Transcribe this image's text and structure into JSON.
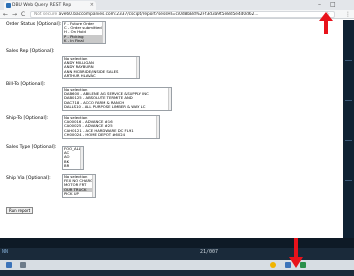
{
  "browser": {
    "tab_title": "DBU Web Query REST Rep",
    "tab_close": "×",
    "win_min": "–",
    "win_max": "□",
    "back": "←",
    "forward": "→",
    "reload": "C",
    "not_secure": "Not secure",
    "url": "ave60.baccompanies.com:2337/cscipt/report?sessHI=ci0d8bBd%2Ff3d3a9t5e8d5e4d0d62...",
    "star": "☆",
    "menu": "⋮"
  },
  "form": {
    "order_status": {
      "label": "Order Status [Optional]:",
      "options": [
        "F - Future Order",
        "C - Order submitted",
        "H - On Hold",
        "P - Picking",
        "K - In Final"
      ],
      "highlighted": [
        3,
        4
      ]
    },
    "sales_rep": {
      "label": "Sales Rep [Optional]:",
      "options": [
        "No selection",
        "ANDY MILLIGAN",
        "ANDY RAYBURN",
        "ANN MCBRIDE/INSIDE SALES",
        "ARTHUR HLAVAC"
      ]
    },
    "bill_to": {
      "label": "Bill-To [Optional]:",
      "options": [
        "No selection",
        "DAB600 - ABILENE AG SERVICE &SUPPLY INC",
        "DAB0125 - ABSOLUTE TERMITE AND",
        "DAC718 - ACCO FARM & RANCH",
        "DALLS10 - ALL PURPOSE LIMBER & WAY LC"
      ]
    },
    "ship_to": {
      "label": "Ship-To [Optional]:",
      "options": [
        "No selection",
        "CA00016 - ADVANCE #16",
        "CA00025 - ADVANCE #25",
        "CAH0121 - ACE HARDWARE DC FL91",
        "CH00024 - HOME DEPOT #6024"
      ]
    },
    "sales_type": {
      "label": "Sales Type [Optional]:",
      "options": [
        "FOO_ALL",
        "AC",
        "AO",
        "BK",
        "BR"
      ]
    },
    "ship_via": {
      "label": "Ship Via [Optional]:",
      "options": [
        "No selection",
        "FEX NO CHARGE",
        "MOTOR FRT",
        "OUR TRUCK",
        "PICK UP"
      ],
      "highlighted": [
        3
      ]
    },
    "run_button": "Run report"
  },
  "taskbar": {
    "status_left": "NN",
    "status_mid": "21/007"
  },
  "colors": {
    "annotation_arrow": "#e8121b",
    "taskbar_bg": "#1a2a3a"
  }
}
